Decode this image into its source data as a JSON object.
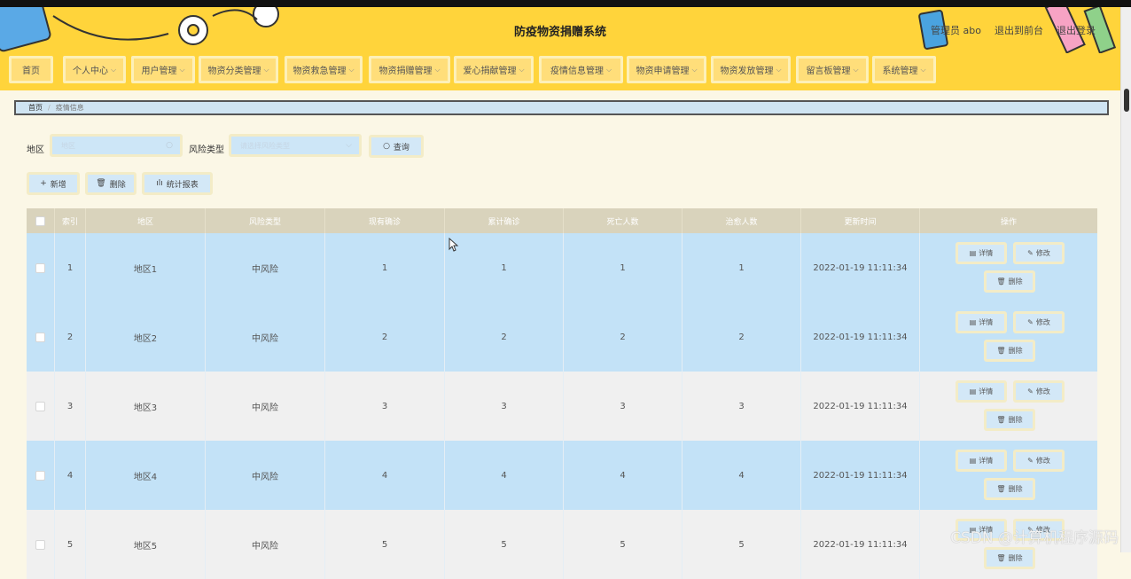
{
  "header": {
    "title": "防疫物资捐赠系统",
    "user_label": "管理员 abo",
    "back_to_front": "退出到前台",
    "logout": "退出登录"
  },
  "nav": [
    {
      "label": "首页",
      "dropdown": false
    },
    {
      "label": "个人中心",
      "dropdown": true
    },
    {
      "label": "用户管理",
      "dropdown": true
    },
    {
      "label": "物资分类管理",
      "dropdown": true
    },
    {
      "label": "物资救急管理",
      "dropdown": true
    },
    {
      "label": "物资捐赠管理",
      "dropdown": true
    },
    {
      "label": "爱心捐献管理",
      "dropdown": true
    },
    {
      "label": "疫情信息管理",
      "dropdown": true
    },
    {
      "label": "物资申请管理",
      "dropdown": true
    },
    {
      "label": "物资发放管理",
      "dropdown": true
    },
    {
      "label": "留言板管理",
      "dropdown": true
    },
    {
      "label": "系统管理",
      "dropdown": true
    }
  ],
  "breadcrumb": {
    "home": "首页",
    "current": "疫情信息"
  },
  "filters": {
    "region_label": "地区",
    "region_placeholder": "地区",
    "risk_label": "风险类型",
    "risk_placeholder": "请选择风险类型",
    "search_button": "查询"
  },
  "actions": {
    "add": "新增",
    "delete": "删除",
    "report": "统计报表"
  },
  "table": {
    "columns": [
      "索引",
      "地区",
      "风险类型",
      "现有确诊",
      "累计确诊",
      "死亡人数",
      "治愈人数",
      "更新时间",
      "操作"
    ],
    "rows": [
      {
        "index": "1",
        "region": "地区1",
        "risk": "中风险",
        "current": "1",
        "total": "1",
        "deaths": "1",
        "cured": "1",
        "updated": "2022-01-19 11:11:34",
        "style": "blue"
      },
      {
        "index": "2",
        "region": "地区2",
        "risk": "中风险",
        "current": "2",
        "total": "2",
        "deaths": "2",
        "cured": "2",
        "updated": "2022-01-19 11:11:34",
        "style": "blue"
      },
      {
        "index": "3",
        "region": "地区3",
        "risk": "中风险",
        "current": "3",
        "total": "3",
        "deaths": "3",
        "cured": "3",
        "updated": "2022-01-19 11:11:34",
        "style": "gray"
      },
      {
        "index": "4",
        "region": "地区4",
        "risk": "中风险",
        "current": "4",
        "total": "4",
        "deaths": "4",
        "cured": "4",
        "updated": "2022-01-19 11:11:34",
        "style": "blue"
      },
      {
        "index": "5",
        "region": "地区5",
        "risk": "中风险",
        "current": "5",
        "total": "5",
        "deaths": "5",
        "cured": "5",
        "updated": "2022-01-19 11:11:34",
        "style": "gray"
      }
    ],
    "op_labels": {
      "detail": "详情",
      "edit": "修改",
      "delete": "删除"
    }
  },
  "watermark": "CSDN @计算机程序源码",
  "colors": {
    "header": "#ffd43b",
    "row_blue": "#c3e2f7",
    "row_gray": "#f0f0f0",
    "thead": "#d9d3bc"
  }
}
